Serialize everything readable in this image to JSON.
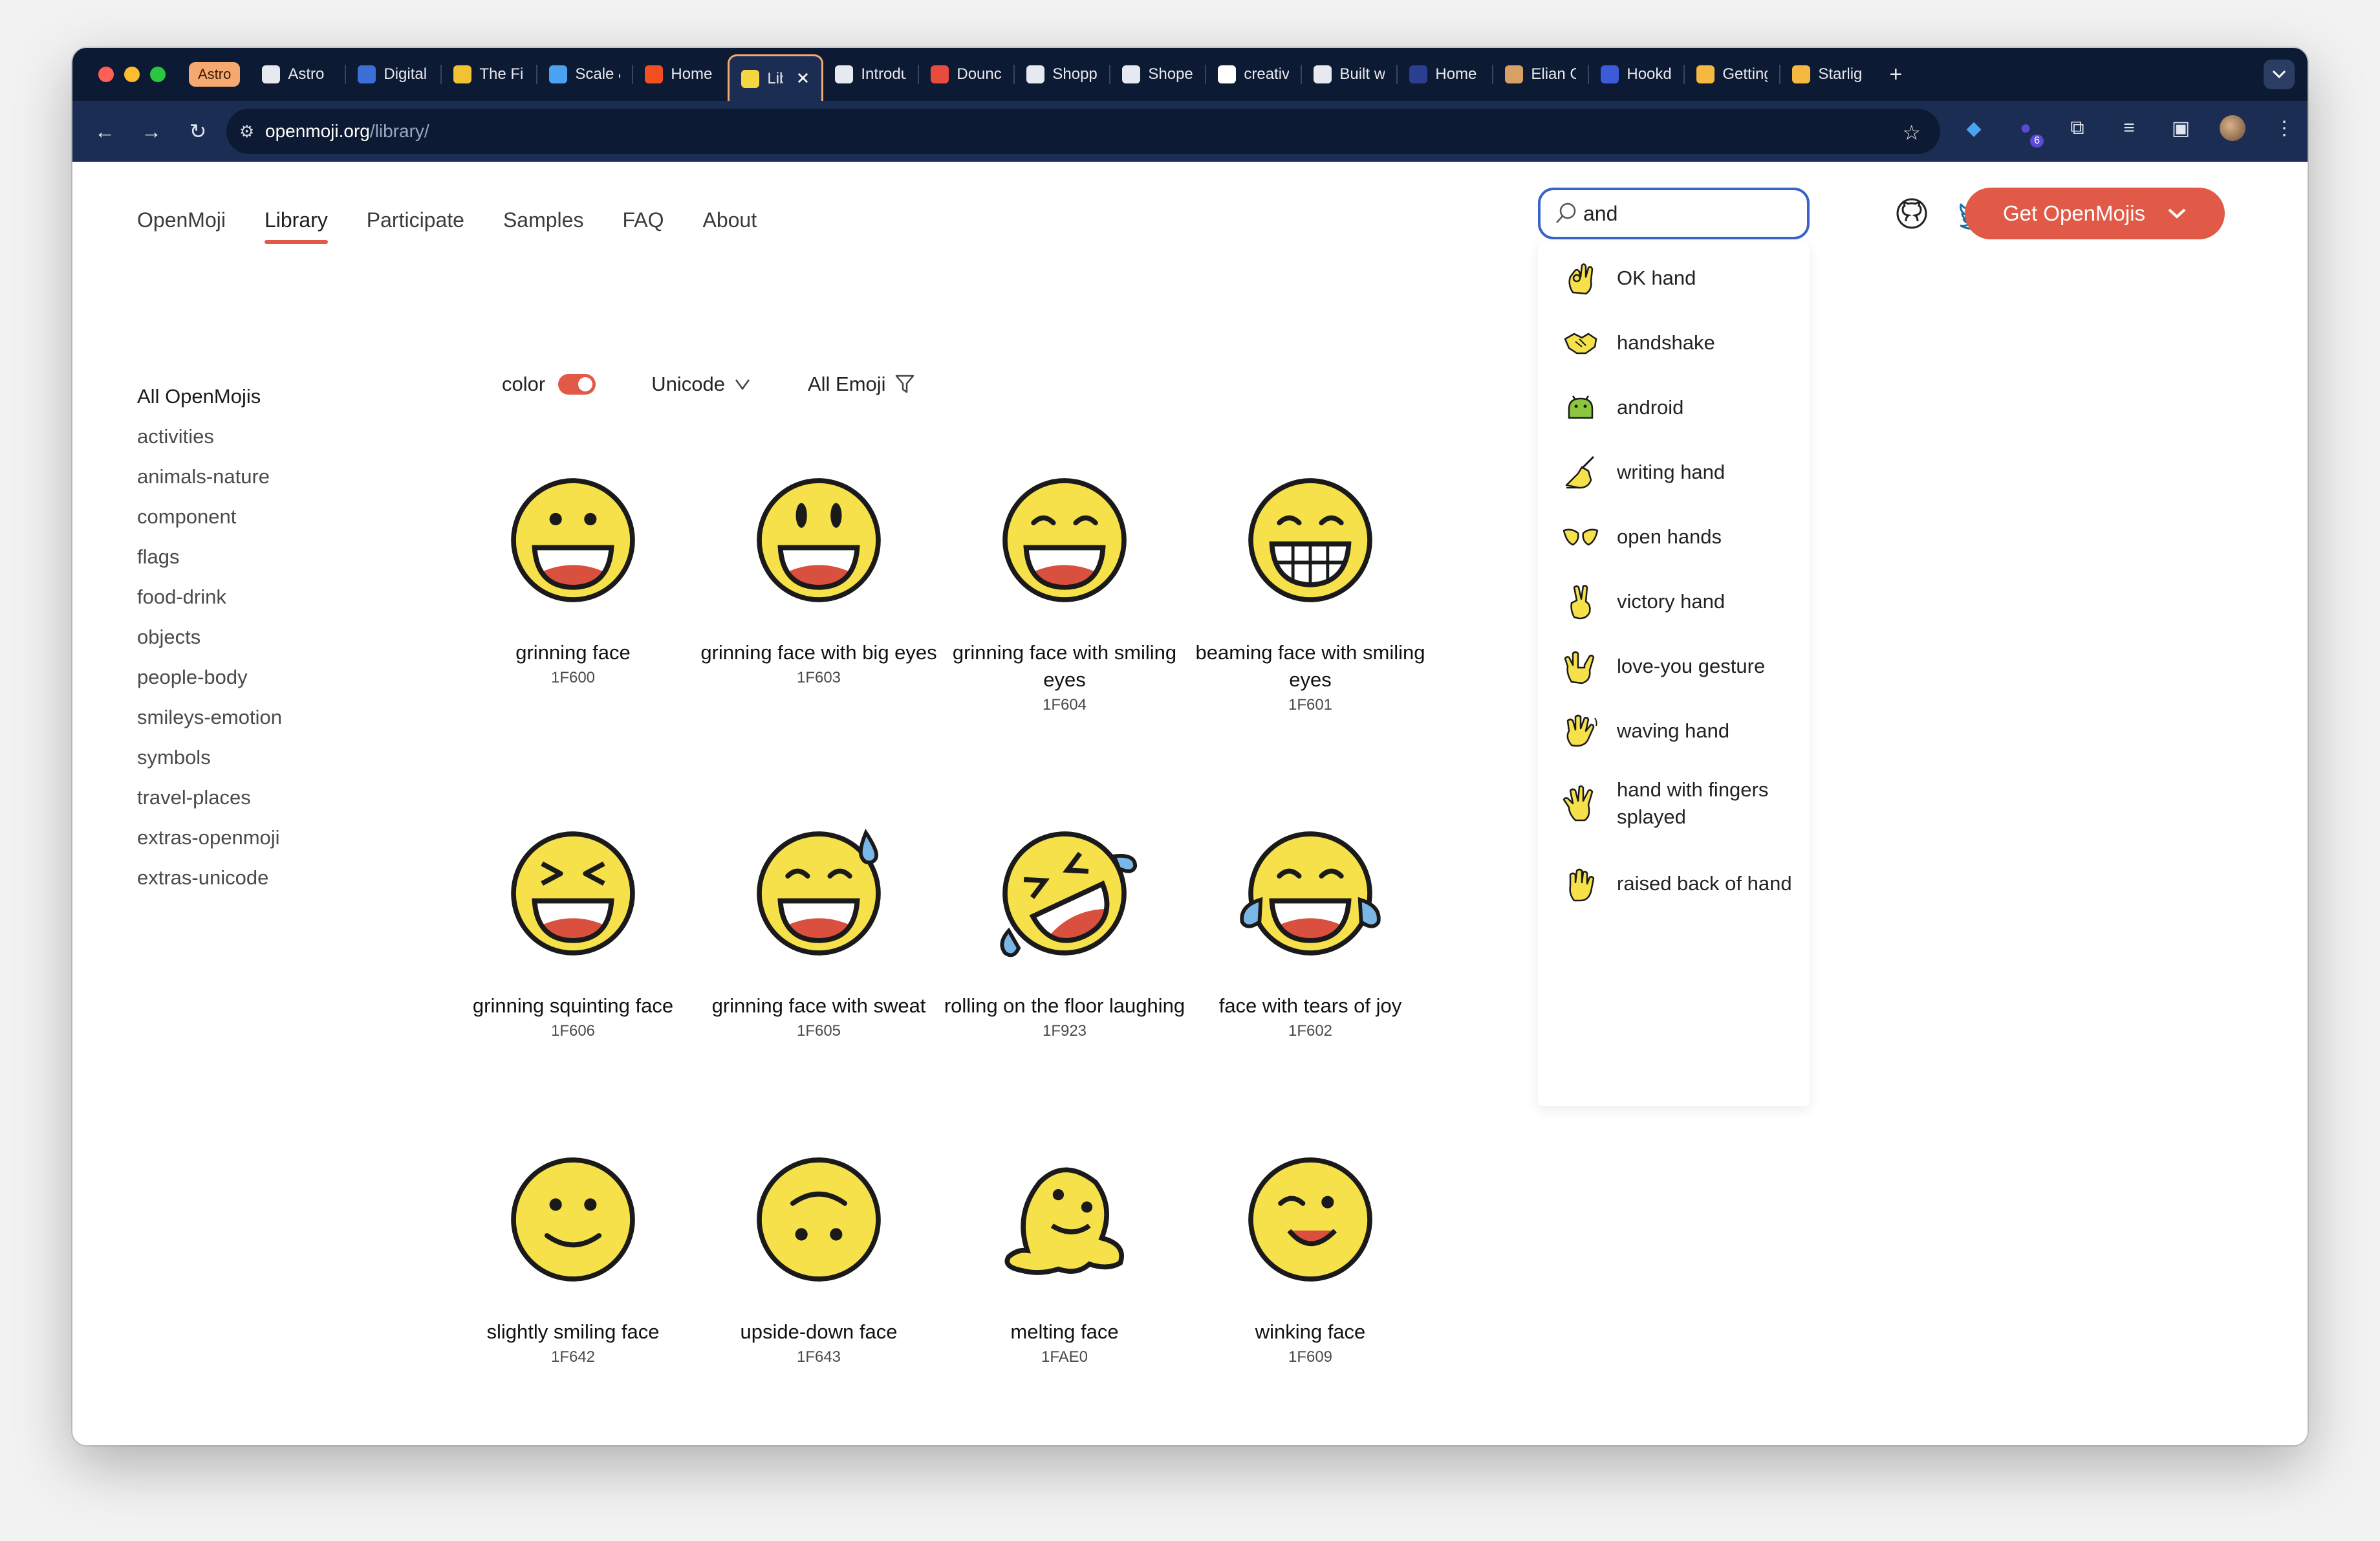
{
  "browser": {
    "tab_group_label": "Astro",
    "tabs": [
      {
        "title": "Astro",
        "color": "#e6e9f0"
      },
      {
        "title": "Digital",
        "color": "#3b6fd8"
      },
      {
        "title": "The Fir",
        "color": "#f1c232"
      },
      {
        "title": "Scale &",
        "color": "#4aa3f0"
      },
      {
        "title": "Home",
        "color": "#f25022"
      },
      {
        "title": "Lib",
        "color": "#f5d743",
        "active": true
      },
      {
        "title": "Introdu",
        "color": "#e6e9f0"
      },
      {
        "title": "Dounc",
        "color": "#e74c3c"
      },
      {
        "title": "Shoppi",
        "color": "#e6e9f0"
      },
      {
        "title": "Shope",
        "color": "#e6e9f0"
      },
      {
        "title": "creativ",
        "color": "#ffffff"
      },
      {
        "title": "Built w",
        "color": "#e6e9f0"
      },
      {
        "title": "Home",
        "color": "#2c3e90"
      },
      {
        "title": "Elian C",
        "color": "#d9a066"
      },
      {
        "title": "Hookd",
        "color": "#3b5bd9"
      },
      {
        "title": "Getting",
        "color": "#f5b942"
      },
      {
        "title": "Starlig",
        "color": "#f5b942"
      }
    ],
    "close_glyph": "✕",
    "new_tab_glyph": "+",
    "url_domain": "openmoji.org",
    "url_path": "/library/",
    "extension_badge": "6"
  },
  "nav": {
    "items": [
      "OpenMoji",
      "Library",
      "Participate",
      "Samples",
      "FAQ",
      "About"
    ],
    "active": "Library"
  },
  "search": {
    "value": "and",
    "suggestions": [
      {
        "label": "OK hand",
        "icon": "ok-hand"
      },
      {
        "label": "handshake",
        "icon": "handshake"
      },
      {
        "label": "android",
        "icon": "android"
      },
      {
        "label": "writing hand",
        "icon": "writing-hand"
      },
      {
        "label": "open hands",
        "icon": "open-hands"
      },
      {
        "label": "victory hand",
        "icon": "victory-hand"
      },
      {
        "label": "love-you gesture",
        "icon": "love-you-gesture"
      },
      {
        "label": "waving hand",
        "icon": "waving-hand"
      },
      {
        "label": "hand with fingers splayed",
        "icon": "hand-fingers-splayed"
      },
      {
        "label": "raised back of hand",
        "icon": "raised-back-of-hand"
      }
    ]
  },
  "cta": {
    "label": "Get OpenMojis"
  },
  "sidebar": {
    "items": [
      "All OpenMojis",
      "activities",
      "animals-nature",
      "component",
      "flags",
      "food-drink",
      "objects",
      "people-body",
      "smileys-emotion",
      "symbols",
      "travel-places",
      "extras-openmoji",
      "extras-unicode"
    ]
  },
  "filters": {
    "color_label": "color",
    "color_on": true,
    "sort_label": "Unicode",
    "category_label": "All Emoji"
  },
  "emojis": [
    {
      "name": "grinning face",
      "code": "1F600",
      "icon": "grinning-face"
    },
    {
      "name": "grinning face with big eyes",
      "code": "1F603",
      "icon": "grinning-face-big-eyes"
    },
    {
      "name": "grinning face with smiling eyes",
      "code": "1F604",
      "icon": "grinning-face-smiling-eyes"
    },
    {
      "name": "beaming face with smiling eyes",
      "code": "1F601",
      "icon": "beaming-face"
    },
    {
      "name": "grinning squinting face",
      "code": "1F606",
      "icon": "squinting-face"
    },
    {
      "name": "grinning face with sweat",
      "code": "1F605",
      "icon": "face-with-sweat"
    },
    {
      "name": "rolling on the floor laughing",
      "code": "1F923",
      "icon": "rofl-face"
    },
    {
      "name": "face with tears of joy",
      "code": "1F602",
      "icon": "tears-of-joy-face"
    },
    {
      "name": "slightly smiling face",
      "code": "1F642",
      "icon": "slightly-smiling-face"
    },
    {
      "name": "upside-down face",
      "code": "1F643",
      "icon": "upside-down-face"
    },
    {
      "name": "melting face",
      "code": "1FAE0",
      "icon": "melting-face"
    },
    {
      "name": "winking face",
      "code": "1F609",
      "icon": "winking-face"
    }
  ],
  "colors": {
    "accent": "#e05a47",
    "emoji_yellow": "#f6e14b",
    "tab_bar": "#0d1a33",
    "toolbar": "#1b2d52"
  }
}
